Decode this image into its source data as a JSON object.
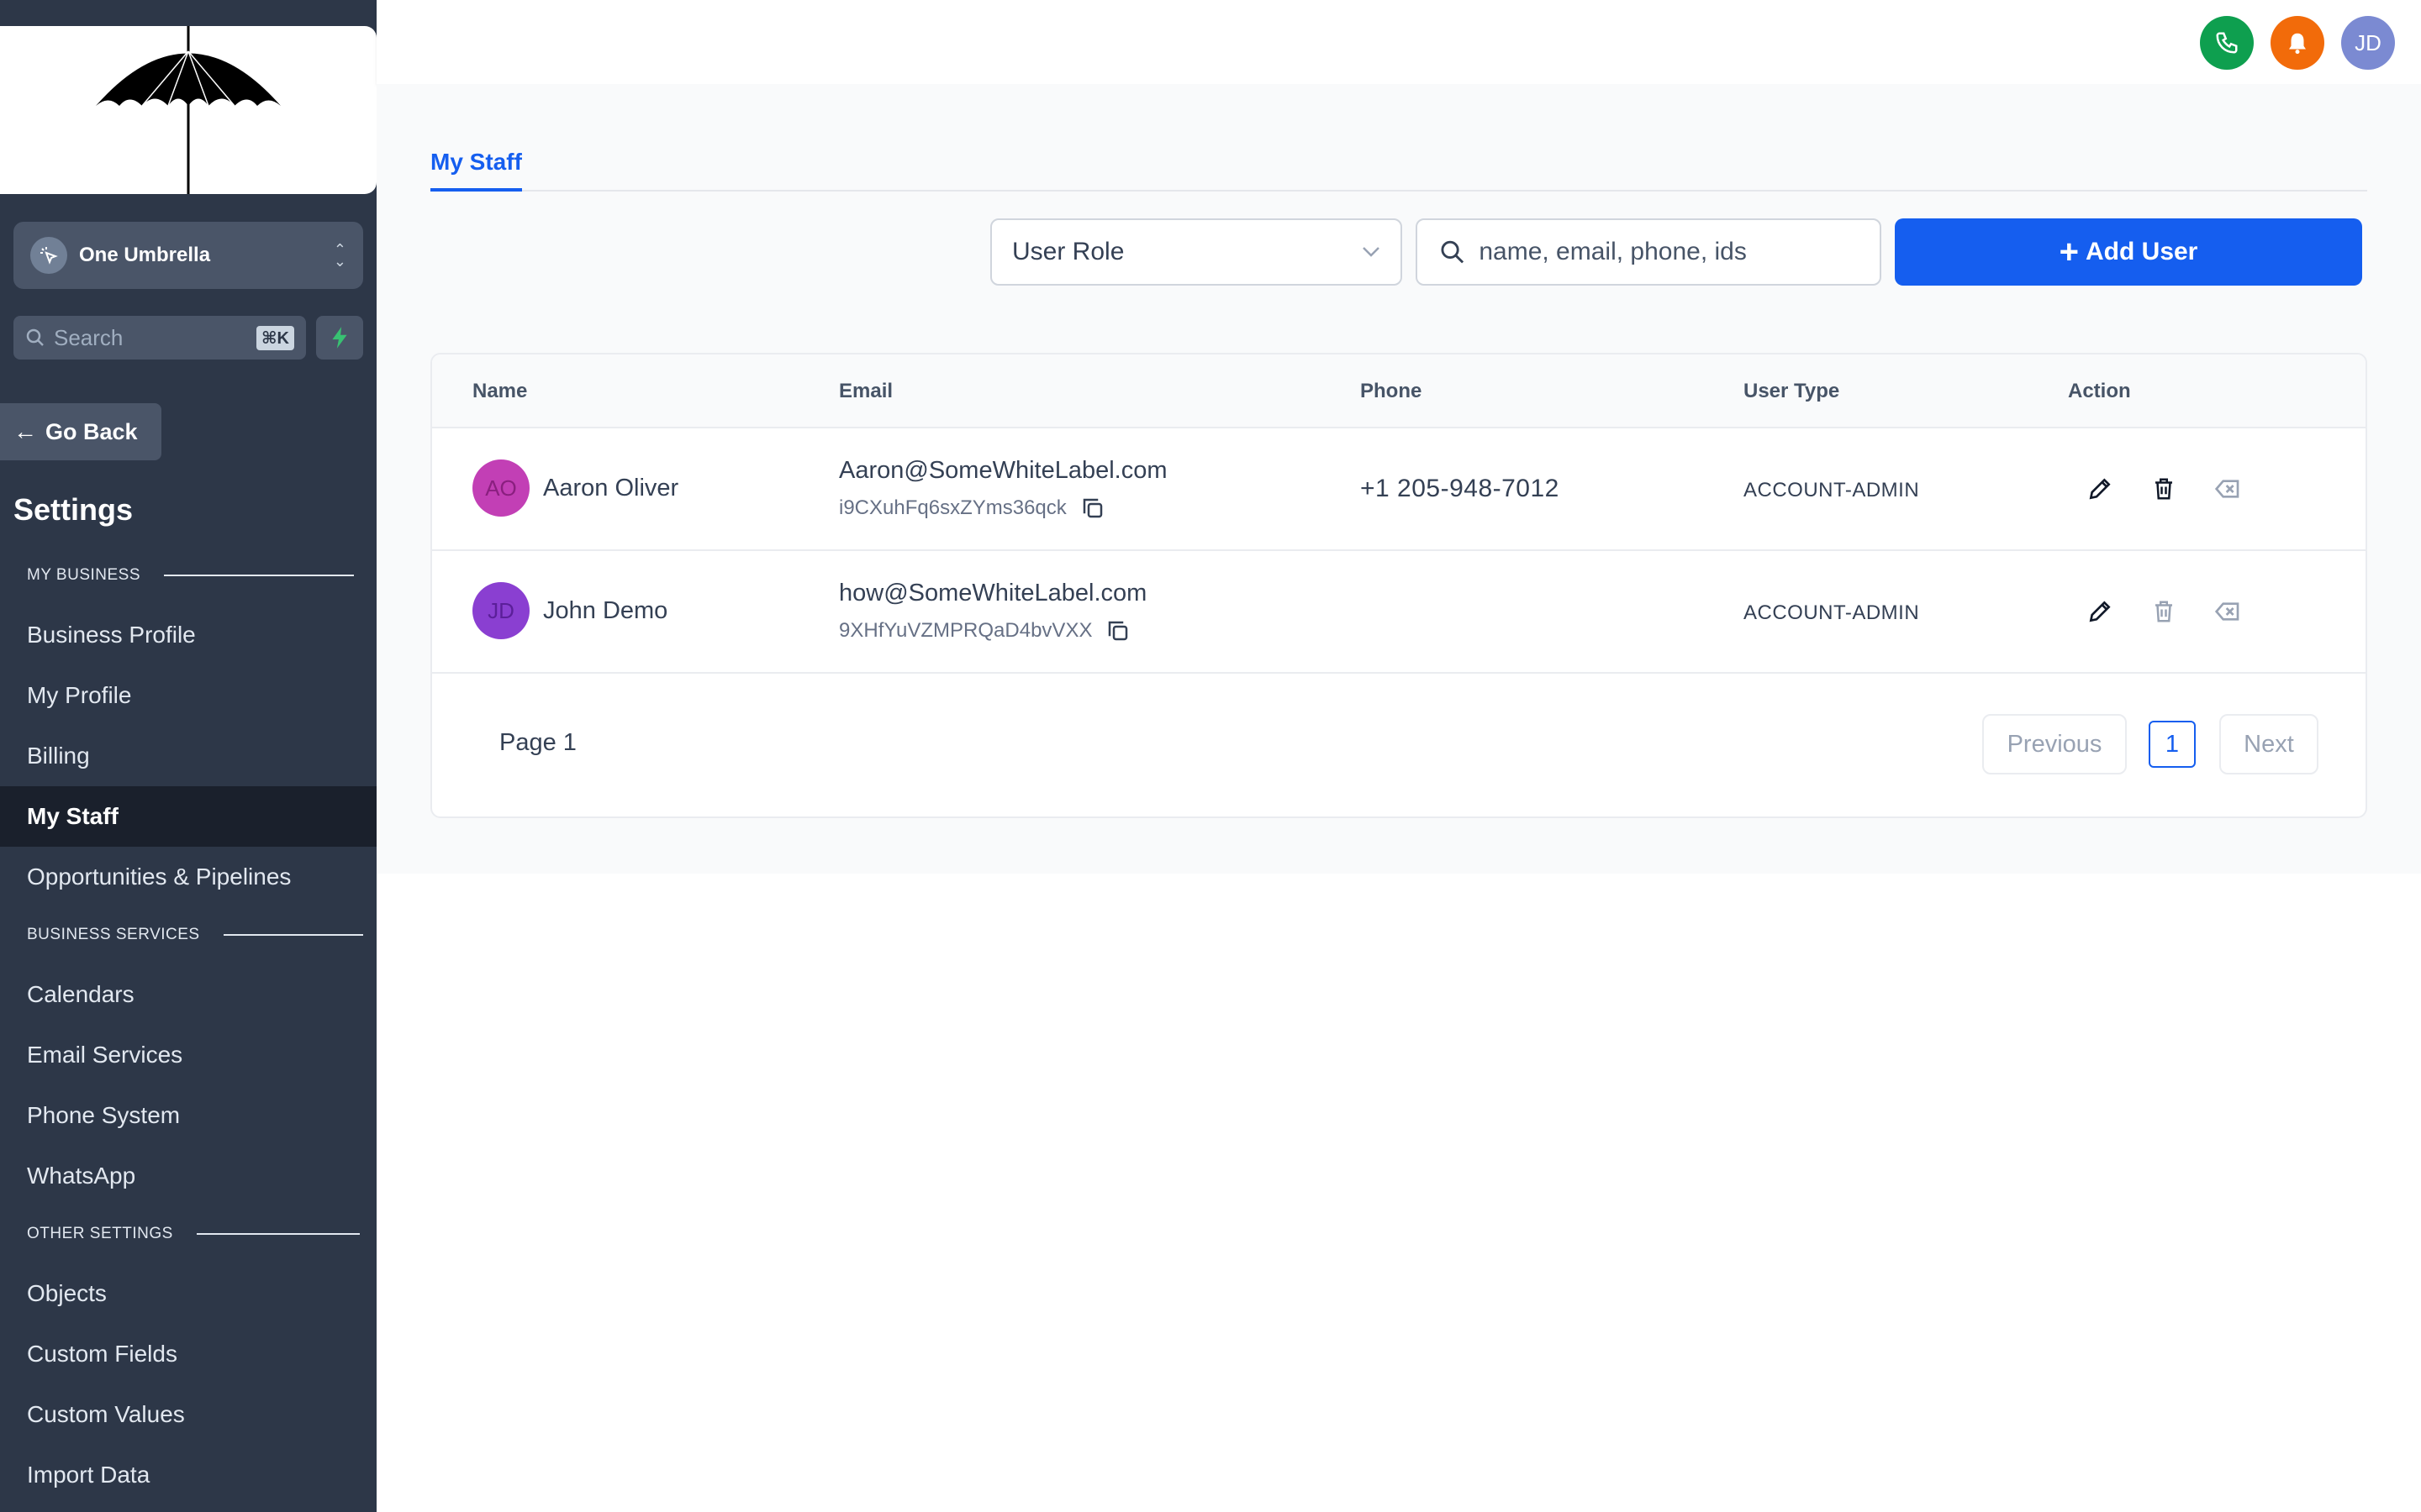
{
  "sidebar": {
    "account_name": "One Umbrella",
    "search_placeholder": "Search",
    "search_shortcut": "⌘K",
    "go_back": "Go Back",
    "settings_title": "Settings",
    "sections": [
      {
        "title": "MY BUSINESS",
        "items": [
          "Business Profile",
          "My Profile",
          "Billing",
          "My Staff",
          "Opportunities & Pipelines"
        ]
      },
      {
        "title": "BUSINESS SERVICES",
        "items": [
          "Calendars",
          "Email Services",
          "Phone System",
          "WhatsApp"
        ]
      },
      {
        "title": "OTHER SETTINGS",
        "items": [
          "Objects",
          "Custom Fields",
          "Custom Values",
          "Import Data"
        ]
      }
    ],
    "active_item": "My Staff"
  },
  "topbar": {
    "user_initials": "JD",
    "colors": {
      "phone": "#0e9f4f",
      "bell": "#f26b0a",
      "avatar": "#7b8ad2"
    }
  },
  "main": {
    "tab": "My Staff",
    "role_select": "User Role",
    "search_placeholder": "name, email, phone, ids",
    "add_user": "Add User",
    "columns": [
      "Name",
      "Email",
      "Phone",
      "User Type",
      "Action"
    ],
    "rows": [
      {
        "initials": "AO",
        "name": "Aaron Oliver",
        "email": "Aaron@SomeWhiteLabel.com",
        "id": "i9CXuhFq6sxZYms36qck",
        "phone": "+1 205-948-7012",
        "type": "ACCOUNT-ADMIN",
        "avatar_color": "#c23fb5"
      },
      {
        "initials": "JD",
        "name": "John Demo",
        "email": "how@SomeWhiteLabel.com",
        "id": "9XHfYuVZMPRQaD4bvVXX",
        "phone": "",
        "type": "ACCOUNT-ADMIN",
        "avatar_color": "#8a3fd1"
      }
    ],
    "pagination": {
      "label": "Page 1",
      "previous": "Previous",
      "current": "1",
      "next": "Next"
    }
  },
  "colors": {
    "accent": "#155eef",
    "sidebar_bg": "#2d3748"
  }
}
